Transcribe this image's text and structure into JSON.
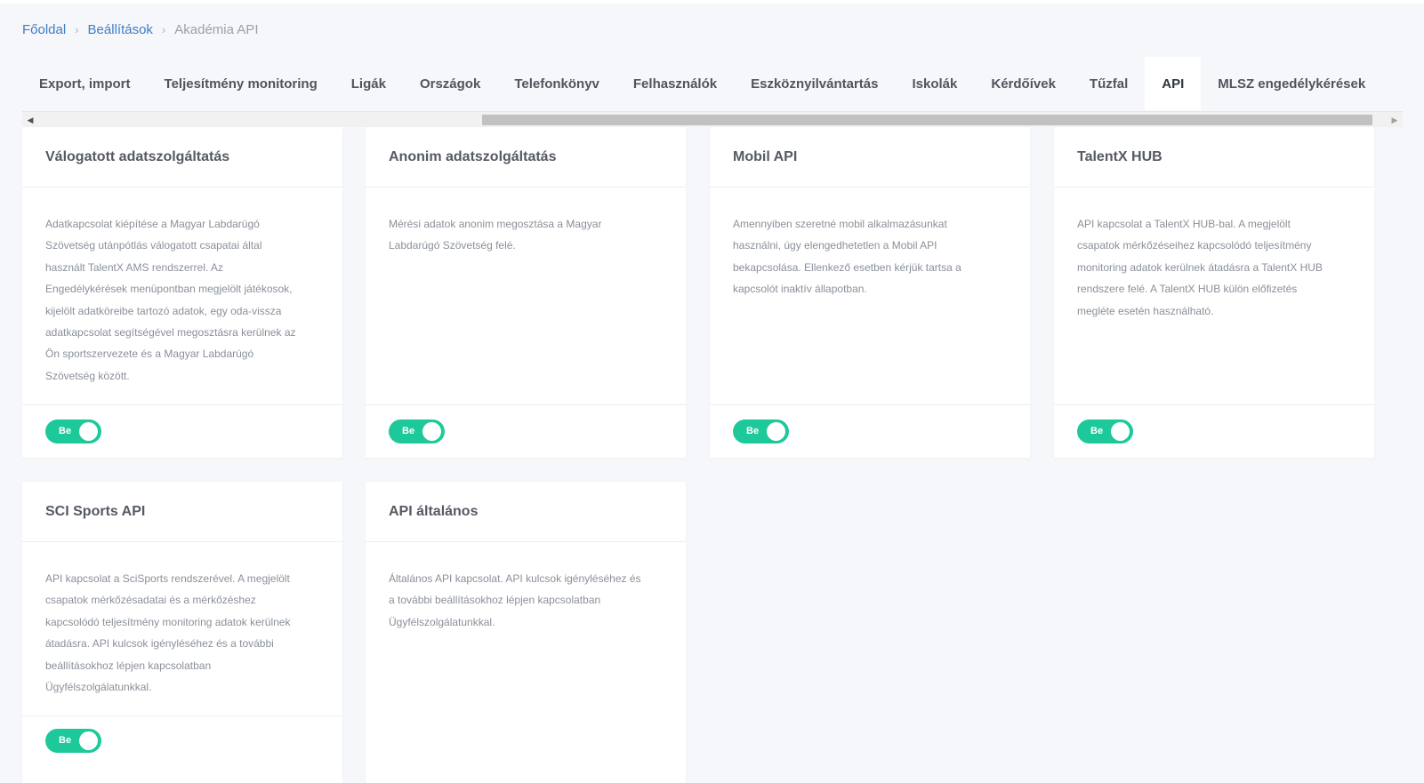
{
  "breadcrumb": {
    "items": [
      "Főoldal",
      "Beállítások"
    ],
    "current": "Akadémia API",
    "separator": "›"
  },
  "tabs": [
    {
      "label": "Export, import"
    },
    {
      "label": "Teljesítmény monitoring"
    },
    {
      "label": "Ligák"
    },
    {
      "label": "Országok"
    },
    {
      "label": "Telefonkönyv"
    },
    {
      "label": "Felhasználók"
    },
    {
      "label": "Eszköznyilvántartás"
    },
    {
      "label": "Iskolák"
    },
    {
      "label": "Kérdőívek"
    },
    {
      "label": "Tűzfal"
    },
    {
      "label": "API",
      "active": true
    },
    {
      "label": "MLSZ engedélykérések"
    }
  ],
  "scrollbar": {
    "left_arrow": "◀",
    "right_arrow": "▶"
  },
  "cards": [
    {
      "title": "Válogatott adatszolgáltatás",
      "lines": [
        "Adatkapcsolat kiépítése a Magyar Labdarúgó",
        "Szövetség utánpótlás válogatott csapatai által",
        "használt TalentX AMS rendszerrel. Az",
        "Engedélykérések menüpontban megjelölt játékosok,",
        "kijelölt adatköreibe tartozó adatok, egy oda-vissza",
        "adatkapcsolat segítségével megosztásra kerülnek az",
        "Ön sportszervezete és a Magyar Labdarúgó",
        "Szövetség között."
      ],
      "toggle": "Be"
    },
    {
      "title": "Anonim adatszolgáltatás",
      "lines": [
        "Mérési adatok anonim megosztása a Magyar",
        "Labdarúgó Szövetség felé."
      ],
      "toggle": "Be"
    },
    {
      "title": "Mobil API",
      "lines": [
        "Amennyiben szeretné mobil alkalmazásunkat",
        "használni, úgy elengedhetetlen a Mobil API",
        "bekapcsolása. Ellenkező esetben kérjük tartsa a",
        "kapcsolót inaktív állapotban."
      ],
      "toggle": "Be"
    },
    {
      "title": "TalentX HUB",
      "lines": [
        "API kapcsolat a TalentX HUB-bal. A megjelölt",
        "csapatok mérkőzéseihez kapcsolódó teljesítmény",
        "monitoring adatok kerülnek átadásra a TalentX HUB",
        "rendszere felé. A TalentX HUB külön előfizetés",
        "megléte esetén használható."
      ],
      "toggle": "Be"
    },
    {
      "title": "SCI Sports API",
      "lines": [
        "API kapcsolat a SciSports rendszerével. A megjelölt",
        "csapatok mérkőzésadatai és a mérkőzéshez",
        "kapcsolódó teljesítmény monitoring adatok kerülnek",
        "átadásra. API kulcsok igényléséhez és a további",
        "beállításokhoz lépjen kapcsolatban",
        "Ügyfélszolgálatunkkal."
      ],
      "toggle": "Be"
    },
    {
      "title": "API általános",
      "lines": [
        "Általános API kapcsolat. API kulcsok igényléséhez és",
        "a további beállításokhoz lépjen kapcsolatban",
        "Ügyfélszolgálatunkkal."
      ]
    }
  ],
  "colors": {
    "toggle_on": "#1dc99b",
    "link": "#3f7cc4",
    "background": "#f6f7fa"
  }
}
